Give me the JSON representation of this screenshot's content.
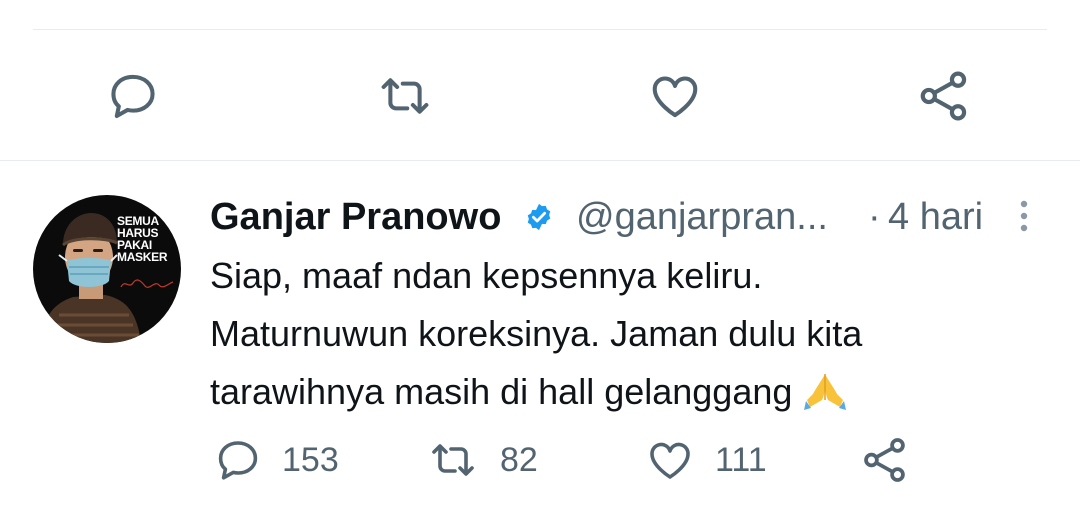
{
  "tweet": {
    "author_name": "Ganjar Pranowo",
    "handle": "@ganjarpran...",
    "separator": "·",
    "time": "4 hari",
    "text_line1": "Siap, maaf ndan kepsennya keliru.",
    "text_line2": "Maturnuwun koreksinya. Jaman dulu kita",
    "text_line3": "tarawihnya masih di hall gelanggang",
    "emoji": "folded-hands-emoji",
    "avatar_poster": {
      "line1": "SEMUA",
      "line2": "HARUS",
      "line3": "PAKAI",
      "line4": "MASKER"
    }
  },
  "stats": {
    "replies": "153",
    "retweets": "82",
    "likes": "111"
  },
  "icons": {
    "reply": "reply-icon",
    "retweet": "retweet-icon",
    "like": "heart-icon",
    "share": "share-icon",
    "verified": "verified-badge-icon",
    "more": "more-vertical-icon"
  },
  "colors": {
    "text": "#0f1419",
    "secondary": "#536471",
    "verified": "#1d9bf0",
    "divider": "#e6ecf0"
  }
}
